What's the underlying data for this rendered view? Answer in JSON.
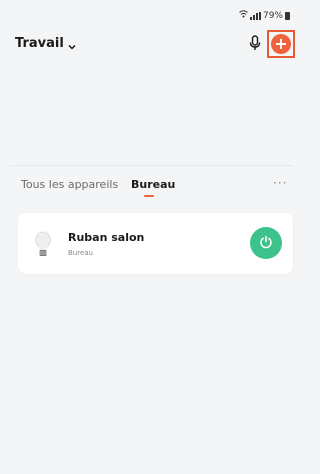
{
  "status_bar": {
    "battery": "79%"
  },
  "header": {
    "home_name": "Travail"
  },
  "tabs": [
    {
      "label": "Tous les appareils",
      "active": false
    },
    {
      "label": "Bureau",
      "active": true
    }
  ],
  "more_label": "···",
  "devices": [
    {
      "name": "Ruban salon",
      "room": "Bureau",
      "icon": "bulb-icon",
      "power_color": "#3cc28a"
    }
  ],
  "colors": {
    "accent": "#f0623b",
    "power_on": "#3cc28a",
    "background": "#f4f5f7"
  }
}
